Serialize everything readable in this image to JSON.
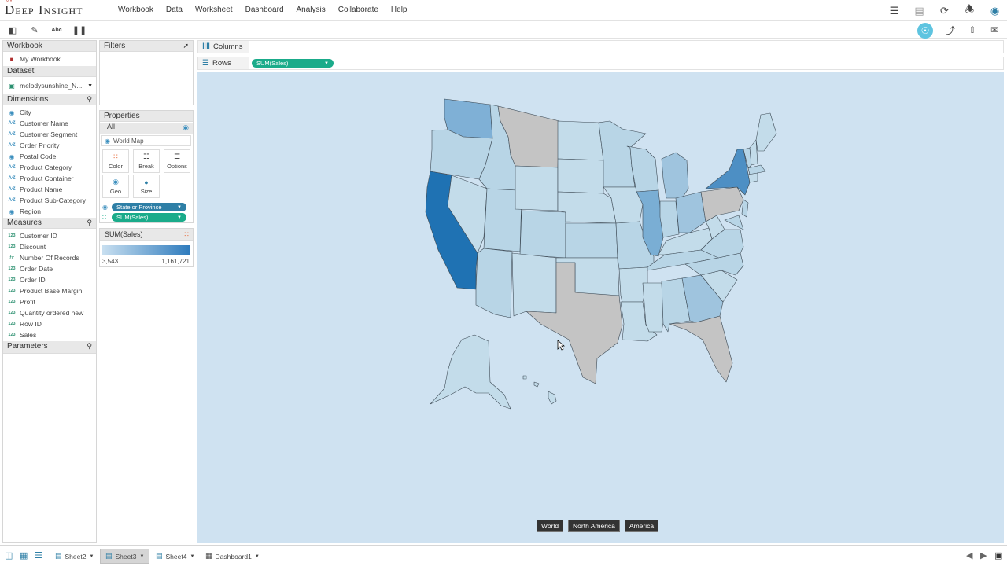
{
  "app": {
    "logo_prefix": "MY",
    "logo": "Deep Insight"
  },
  "menu": [
    "Workbook",
    "Data",
    "Worksheet",
    "Dashboard",
    "Analysis",
    "Collaborate",
    "Help"
  ],
  "workbook": {
    "header": "Workbook",
    "name": "My Workbook"
  },
  "dataset": {
    "header": "Dataset",
    "name": "melodysunshine_N..."
  },
  "dimensions": {
    "header": "Dimensions",
    "items": [
      {
        "label": "City",
        "icon": "globe-icon"
      },
      {
        "label": "Customer Name",
        "icon": "abc-icon"
      },
      {
        "label": "Customer Segment",
        "icon": "abc-icon"
      },
      {
        "label": "Order Priority",
        "icon": "abc-icon"
      },
      {
        "label": "Postal Code",
        "icon": "globe-icon"
      },
      {
        "label": "Product Category",
        "icon": "abc-icon"
      },
      {
        "label": "Product Container",
        "icon": "abc-icon"
      },
      {
        "label": "Product Name",
        "icon": "abc-icon"
      },
      {
        "label": "Product Sub-Category",
        "icon": "abc-icon"
      },
      {
        "label": "Region",
        "icon": "globe-icon"
      }
    ]
  },
  "measures": {
    "header": "Measures",
    "items": [
      {
        "label": "Customer ID",
        "icon": "number-icon"
      },
      {
        "label": "Discount",
        "icon": "number-icon"
      },
      {
        "label": "Number Of Records",
        "icon": "fx-icon"
      },
      {
        "label": "Order Date",
        "icon": "number-icon"
      },
      {
        "label": "Order ID",
        "icon": "number-icon"
      },
      {
        "label": "Product Base Margin",
        "icon": "number-icon"
      },
      {
        "label": "Profit",
        "icon": "number-icon"
      },
      {
        "label": "Quantity ordered new",
        "icon": "number-icon"
      },
      {
        "label": "Row ID",
        "icon": "number-icon"
      },
      {
        "label": "Sales",
        "icon": "number-icon"
      }
    ]
  },
  "parameters": {
    "header": "Parameters"
  },
  "filters": {
    "header": "Filters"
  },
  "properties": {
    "header": "Properties",
    "all": "All",
    "map_type": "World Map",
    "marks": {
      "color": "Color",
      "break": "Break",
      "options": "Options",
      "geo": "Geo",
      "size": "Size"
    },
    "pill_geo": "State or Province",
    "pill_measure": "SUM(Sales)"
  },
  "legend": {
    "title": "SUM(Sales)",
    "min": "3,543",
    "max": "1,161,721",
    "color_low": "#c8dff0",
    "color_high": "#2e7bbd"
  },
  "shelves": {
    "columns_label": "Columns",
    "rows_label": "Rows",
    "rows_pill": "SUM(Sales)"
  },
  "map_buttons": [
    "World",
    "North America",
    "America"
  ],
  "sheets": [
    {
      "label": "Sheet2",
      "active": false
    },
    {
      "label": "Sheet3",
      "active": true
    },
    {
      "label": "Sheet4",
      "active": false
    },
    {
      "label": "Dashboard1",
      "active": false
    }
  ],
  "colors": {
    "accent": "#2e7fa6",
    "accent_green": "#1aab8a",
    "map_bg": "#cfe2f1",
    "no_data": "#c4c4c4"
  }
}
